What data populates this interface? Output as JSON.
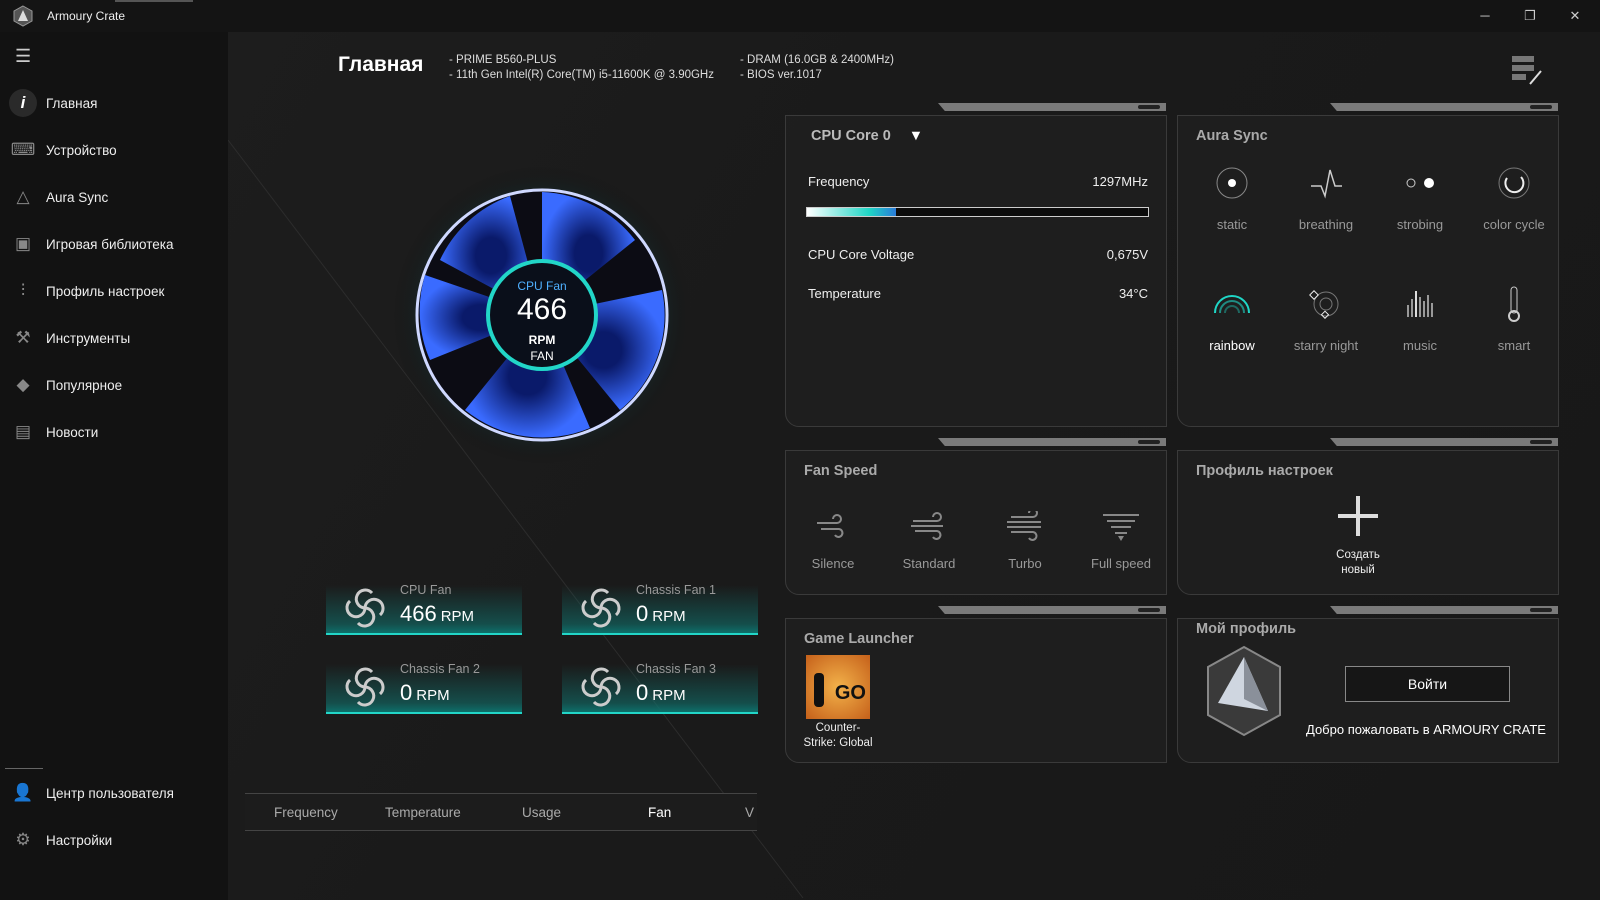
{
  "app": {
    "title": "Armoury Crate"
  },
  "window": {
    "minimize": "─",
    "restore": "❐",
    "close": "✕"
  },
  "sidebar": {
    "items": [
      {
        "label": "Главная",
        "icon": "info-icon",
        "active": true
      },
      {
        "label": "Устройство",
        "icon": "keyboard-icon"
      },
      {
        "label": "Aura Sync",
        "icon": "aura-icon"
      },
      {
        "label": "Игровая библиотека",
        "icon": "gamepad-icon"
      },
      {
        "label": "Профиль настроек",
        "icon": "sliders-icon"
      },
      {
        "label": "Инструменты",
        "icon": "wrench-icon"
      },
      {
        "label": "Популярное",
        "icon": "tag-icon"
      },
      {
        "label": "Новости",
        "icon": "news-icon"
      }
    ],
    "bottom": [
      {
        "label": "Центр пользователя",
        "icon": "user-icon"
      },
      {
        "label": "Настройки",
        "icon": "gear-icon"
      }
    ]
  },
  "header": {
    "title": "Главная",
    "specs": [
      "-  PRIME B560-PLUS",
      "-  11th Gen Intel(R) Core(TM) i5-11600K @ 3.90GHz",
      "-  DRAM (16.0GB & 2400MHz)",
      "-  BIOS ver.1017"
    ]
  },
  "gauge": {
    "label": "CPU Fan",
    "value": "466",
    "unit": "RPM",
    "sub": "FAN"
  },
  "fans": [
    {
      "name": "CPU Fan",
      "value": "466",
      "unit": "RPM"
    },
    {
      "name": "Chassis Fan 1",
      "value": "0",
      "unit": "RPM"
    },
    {
      "name": "Chassis Fan 2",
      "value": "0",
      "unit": "RPM"
    },
    {
      "name": "Chassis Fan 3",
      "value": "0",
      "unit": "RPM"
    }
  ],
  "bottom_tabs": [
    {
      "label": "Frequency"
    },
    {
      "label": "Temperature"
    },
    {
      "label": "Usage"
    },
    {
      "label": "Fan",
      "active": true
    },
    {
      "label": "V"
    }
  ],
  "cpu": {
    "selector": "CPU Core 0",
    "frequency_label": "Frequency",
    "frequency": "1297MHz",
    "frequency_fill_pct": 26,
    "voltage_label": "CPU Core Voltage",
    "voltage": "0,675V",
    "temp_label": "Temperature",
    "temp": "34°C"
  },
  "aura": {
    "title": "Aura Sync",
    "modes": [
      "static",
      "breathing",
      "strobing",
      "color cycle",
      "rainbow",
      "starry night",
      "music",
      "smart"
    ],
    "selected": "rainbow",
    "accent": "#1fd6c6"
  },
  "fan_speed": {
    "title": "Fan Speed",
    "modes": [
      "Silence",
      "Standard",
      "Turbo",
      "Full speed"
    ]
  },
  "profiles": {
    "title": "Профиль настроек",
    "create_line1": "Создать",
    "create_line2": "новый"
  },
  "game_launcher": {
    "title": "Game Launcher",
    "games": [
      {
        "line1": "Counter-",
        "line2": "Strike: Global",
        "logo": "GO"
      }
    ]
  },
  "my_profile": {
    "title": "Мой профиль",
    "login": "Войти",
    "welcome": "Добро пожаловать в ARMOURY CRATE"
  }
}
